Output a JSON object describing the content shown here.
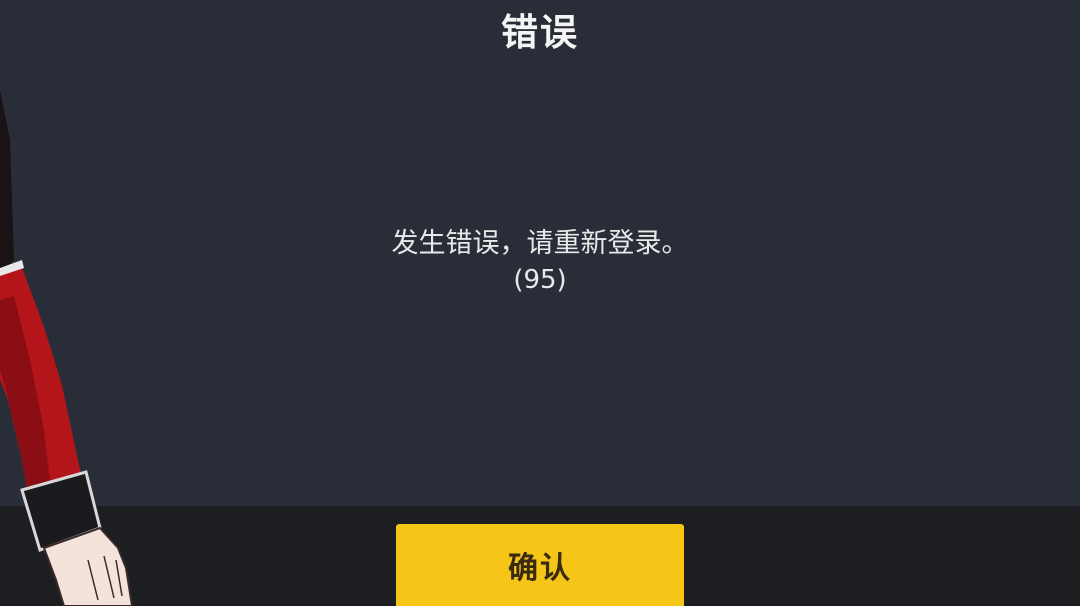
{
  "dialog": {
    "title": "错误",
    "message": "发生错误，请重新登录。",
    "error_code": "(95)"
  },
  "footer": {
    "confirm_label": "确认"
  },
  "colors": {
    "panel_background": "#292d38",
    "footer_background": "#1c1e22",
    "confirm_button": "#f5c518",
    "confirm_text": "#3a2a10",
    "text": "#e9e9e9"
  }
}
